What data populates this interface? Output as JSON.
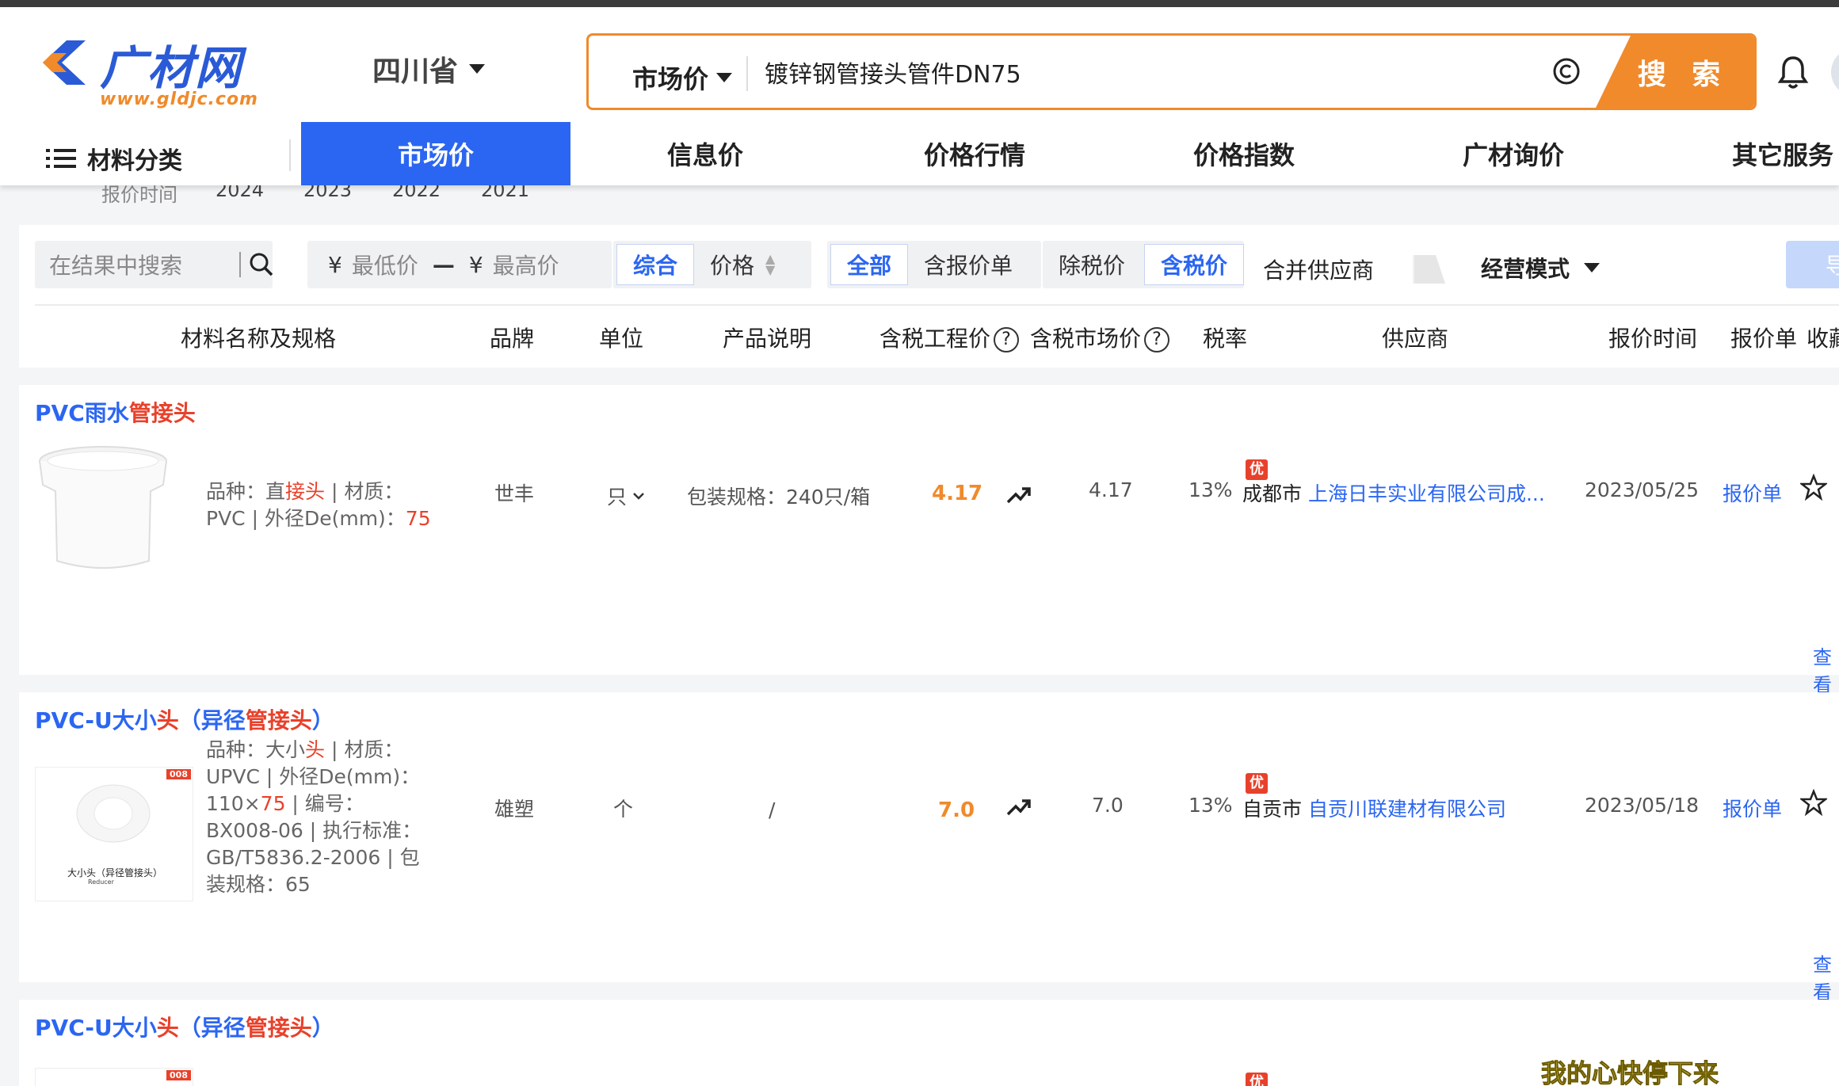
{
  "header": {
    "logo_text": "广材网",
    "logo_url": "www.gldjc.com",
    "region": "四川省",
    "search": {
      "type": "市场价",
      "query": "镀锌钢管接头管件DN75",
      "button": "搜 索"
    }
  },
  "nav": {
    "categories": "材料分类",
    "items": [
      "市场价",
      "信息价",
      "价格行情",
      "价格指数",
      "广材询价",
      "其它服务"
    ]
  },
  "year_filter": {
    "label": "报价时间",
    "years": [
      "2024",
      "2023",
      "2022",
      "2021"
    ]
  },
  "filters": {
    "search_placeholder": "在结果中搜索",
    "min_price": "最低价",
    "max_price": "最高价",
    "currency": "¥",
    "sort": [
      "综合",
      "价格"
    ],
    "scope": [
      "全部",
      "含报价单"
    ],
    "tax": [
      "除税价",
      "含税价"
    ],
    "merge_label": "合并供应商",
    "mode_label": "经营模式",
    "export_label": "导"
  },
  "table_header": {
    "name": "材料名称及规格",
    "brand": "品牌",
    "unit": "单位",
    "desc": "产品说明",
    "eng_price": "含税工程价",
    "mkt_price": "含税市场价",
    "tax_rate": "税率",
    "supplier": "供应商",
    "time": "报价时间",
    "quote": "报价单",
    "fav": "收藏",
    "help_mark": "?"
  },
  "products": [
    {
      "title_a": "PVC雨水",
      "title_hl": "管接头",
      "title_b": "",
      "spec_a": "品种：直",
      "spec_hl1": "接头",
      "spec_b": " | 材质：PVC | 外径De(mm)：",
      "spec_hl2": "75",
      "spec_c": "",
      "brand": "世丰",
      "unit": "只",
      "desc": "包装规格：240只/箱",
      "eng_price": "4.17",
      "mkt_price": "4.17",
      "tax_rate": "13%",
      "badge": "优",
      "city": "成都市",
      "supplier": "上海日丰实业有限公司成...",
      "date": "2023/05/25",
      "quote": "报价单",
      "more": "查看"
    },
    {
      "title_a": "PVC-U大小",
      "title_hl": "头",
      "title_b": "（异径",
      "title_hl2": "管接头",
      "title_c": "）",
      "spec_a": "品种：大小",
      "spec_hl1": "头",
      "spec_b": " | 材质：UPVC | 外径De(mm)：110×",
      "spec_hl2": "75",
      "spec_c": " | 编号：BX008-06 | 执行标准：GB/T5836.2-2006 | 包装规格：65",
      "thumb_badge": "008",
      "thumb_caption": "大小头（异径管接头）",
      "thumb_sub": "Reducer",
      "brand": "雄塑",
      "unit": "个",
      "desc": "/",
      "eng_price": "7.0",
      "mkt_price": "7.0",
      "tax_rate": "13%",
      "badge": "优",
      "city": "自贡市",
      "supplier": "自贡川联建材有限公司",
      "date": "2023/05/18",
      "quote": "报价单",
      "more": "查看"
    },
    {
      "title_a": "PVC-U大小",
      "title_hl": "头",
      "title_b": "（异径",
      "title_hl2": "管接头",
      "title_c": "）",
      "thumb_badge": "008",
      "badge": "优"
    }
  ],
  "overlay_lyric": "我的心快停下来",
  "colors": {
    "brand_blue": "#2b66f2",
    "accent_orange": "#f08a2b",
    "highlight_red": "#e8412b"
  }
}
